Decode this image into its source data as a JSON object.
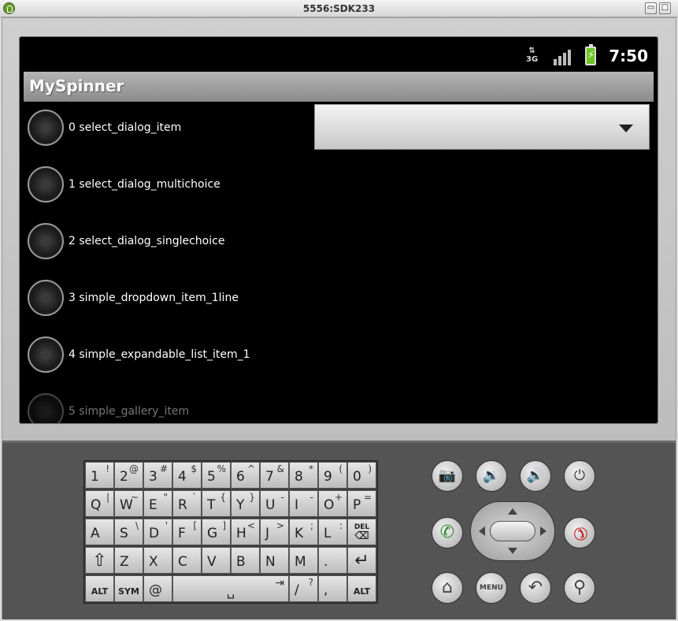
{
  "window": {
    "title": "5556:SDK233",
    "minimize_glyph": "▭",
    "maximize_glyph": "□"
  },
  "statusbar": {
    "network": "3G",
    "time": "7:50",
    "battery_glyph": "⚡"
  },
  "app": {
    "title": "MySpinner"
  },
  "list": {
    "items": [
      {
        "label": "0 select_dialog_item"
      },
      {
        "label": "1 select_dialog_multichoice"
      },
      {
        "label": "2 select_dialog_singlechoice"
      },
      {
        "label": "3 simple_dropdown_item_1line"
      },
      {
        "label": "4 simple_expandable_list_item_1"
      },
      {
        "label": "5 simple_gallery_item"
      }
    ]
  },
  "spinner": {
    "value": ""
  },
  "keyboard": {
    "row1": [
      [
        "1",
        "!"
      ],
      [
        "2",
        "@"
      ],
      [
        "3",
        "#"
      ],
      [
        "4",
        "$"
      ],
      [
        "5",
        "%"
      ],
      [
        "6",
        "^"
      ],
      [
        "7",
        "&"
      ],
      [
        "8",
        "*"
      ],
      [
        "9",
        "("
      ],
      [
        "0",
        ")"
      ]
    ],
    "row2": [
      [
        "Q",
        "|"
      ],
      [
        "W",
        "~"
      ],
      [
        "E",
        "\""
      ],
      [
        "R",
        "`"
      ],
      [
        "T",
        "{"
      ],
      [
        "Y",
        "}"
      ],
      [
        "U",
        "-"
      ],
      [
        "I",
        "-"
      ],
      [
        "O",
        "+"
      ],
      [
        "P",
        "="
      ]
    ],
    "row3": [
      [
        "A",
        ""
      ],
      [
        "S",
        "\\"
      ],
      [
        "D",
        "'"
      ],
      [
        "F",
        "["
      ],
      [
        "G",
        "]"
      ],
      [
        "H",
        "<"
      ],
      [
        "J",
        ">"
      ],
      [
        "K",
        ";"
      ],
      [
        "L",
        ":"
      ],
      [
        "DEL",
        "⌫"
      ]
    ],
    "row4": [
      [
        "⇧",
        ""
      ],
      [
        "Z",
        ""
      ],
      [
        "X",
        ""
      ],
      [
        "C",
        ""
      ],
      [
        "V",
        ""
      ],
      [
        "B",
        ""
      ],
      [
        "N",
        ""
      ],
      [
        "M",
        ""
      ],
      [
        ".",
        ""
      ],
      [
        "↵",
        ""
      ]
    ],
    "row5": {
      "alt_left": "ALT",
      "sym": "SYM",
      "at": "@",
      "space": "␣",
      "tab": "⇥",
      "slash": "/",
      "question": "?",
      "comma": ",",
      "alt_right": "ALT"
    }
  },
  "controls": {
    "camera": "📷",
    "vol_down": "🔉",
    "vol_up": "🔊",
    "power": "⏻",
    "call": "✆",
    "end_call": "✆",
    "home": "⌂",
    "menu": "MENU",
    "back": "↶",
    "search": "⚲"
  },
  "colors": {
    "call": "#2a8a2a",
    "end_call": "#c02020",
    "battery": "#6cc623"
  }
}
